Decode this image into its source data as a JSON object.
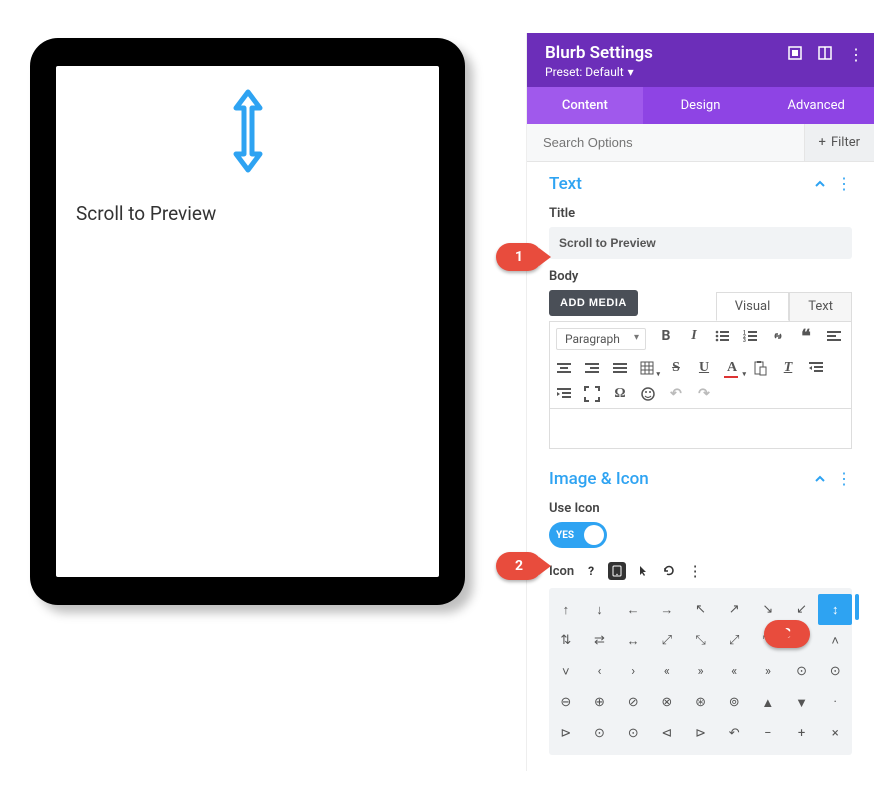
{
  "preview": {
    "title": "Scroll to Preview"
  },
  "panel": {
    "title": "Blurb Settings",
    "preset_label": "Preset: Default"
  },
  "tabs": {
    "content": "Content",
    "design": "Design",
    "advanced": "Advanced"
  },
  "search": {
    "placeholder": "Search Options",
    "filter": "Filter"
  },
  "sections": {
    "text": {
      "title": "Text",
      "title_label": "Title",
      "title_value": "Scroll to Preview",
      "body_label": "Body",
      "add_media": "ADD MEDIA",
      "editor_tabs": {
        "visual": "Visual",
        "text": "Text"
      },
      "paragraph": "Paragraph"
    },
    "image_icon": {
      "title": "Image & Icon",
      "use_icon_label": "Use Icon",
      "toggle_state": "YES",
      "icon_label": "Icon"
    }
  },
  "annotations": {
    "a1": "1",
    "a2": "2",
    "a3": "3"
  },
  "icon_grid": {
    "rows": [
      [
        "↑",
        "↓",
        "←",
        "→",
        "↖",
        "↗",
        "↘",
        "↙",
        "↕"
      ],
      [
        "⇅",
        "⇄",
        "↔",
        "⤢",
        "⤡",
        "⤢",
        "⤡",
        "✥",
        "˄"
      ],
      [
        "˅",
        "‹",
        "›",
        "«",
        "»",
        "«",
        "»",
        "⊙",
        "⊙"
      ],
      [
        "⊖",
        "⊕",
        "⊘",
        "⊗",
        "⊛",
        "⊚",
        "▲",
        "▼",
        "·"
      ],
      [
        "⊳",
        "⊙",
        "⊙",
        "⊲",
        "⊳",
        "↶",
        "−",
        "+",
        "×"
      ]
    ],
    "selected": [
      0,
      8
    ]
  }
}
